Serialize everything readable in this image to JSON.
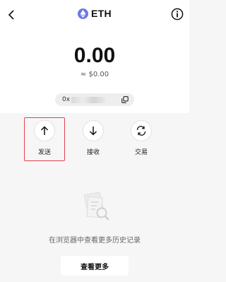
{
  "header": {
    "title": "ETH",
    "back_icon": "chevron-left-icon",
    "token_icon": "ethereum-icon",
    "info_icon": "info-icon"
  },
  "balance": {
    "amount": "0.00",
    "fiat": "≈ $0.00"
  },
  "address": {
    "prefix": "0x",
    "copy_icon": "copy-icon"
  },
  "actions": [
    {
      "label": "发送",
      "icon": "arrow-up-icon"
    },
    {
      "label": "接收",
      "icon": "arrow-down-icon"
    },
    {
      "label": "交易",
      "icon": "swap-icon"
    }
  ],
  "empty": {
    "hint": "在浏览器中查看更多历史记录",
    "button": "查看更多"
  },
  "colors": {
    "highlight": "#e4404e",
    "eth": "#6c77e4",
    "background": "#f6f6f7"
  }
}
